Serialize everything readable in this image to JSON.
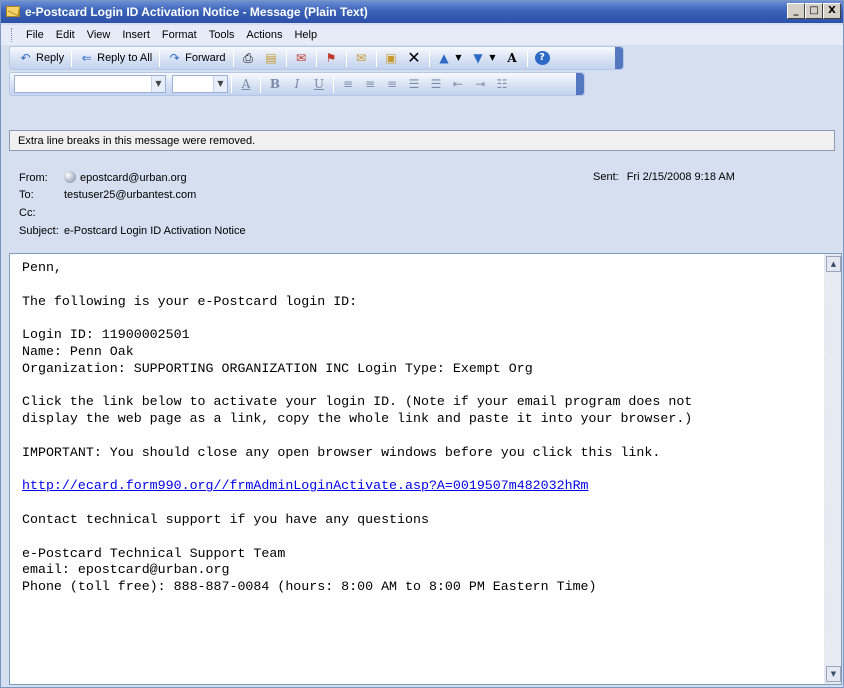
{
  "window": {
    "title": "e-Postcard Login ID Activation Notice - Message (Plain Text)",
    "controls": [
      "_",
      "□",
      "X"
    ]
  },
  "menu": [
    "File",
    "Edit",
    "View",
    "Insert",
    "Format",
    "Tools",
    "Actions",
    "Help"
  ],
  "toolbar": {
    "reply": "Reply",
    "reply_all": "Reply to All",
    "forward": "Forward"
  },
  "format_toolbar": {
    "bold": "B",
    "italic": "I",
    "underline": "U",
    "font_color": "A"
  },
  "infobar": "Extra line breaks in this message were removed.",
  "header": {
    "from_label": "From:",
    "from": "epostcard@urban.org",
    "to_label": "To:",
    "to": "testuser25@urbantest.com",
    "cc_label": "Cc:",
    "cc": "",
    "subject_label": "Subject:",
    "subject": "e-Postcard Login ID Activation Notice",
    "sent_label": "Sent:",
    "sent": "Fri 2/15/2008 9:18 AM"
  },
  "body": {
    "greeting": "Penn,",
    "intro": "The following is your e-Postcard login ID:",
    "login_id": "Login ID: 11900002501",
    "name": "Name: Penn Oak",
    "organization": "Organization: SUPPORTING ORGANIZATION INC Login Type: Exempt Org",
    "click_line1": "Click the link below to activate your login ID. (Note if your email program does not",
    "click_line2": "display the web page as a link, copy the whole link and paste it into your browser.)",
    "important": "IMPORTANT: You should close any open browser windows before you click this link.",
    "link": "http://ecard.form990.org//frmAdminLoginActivate.asp?A=0019507m482032hRm",
    "contact": "Contact technical support if you have any questions",
    "team": "e-Postcard Technical Support Team",
    "email": "email: epostcard@urban.org",
    "phone": "Phone (toll free): 888-887-0084 (hours: 8:00 AM to 8:00 PM Eastern Time)"
  }
}
